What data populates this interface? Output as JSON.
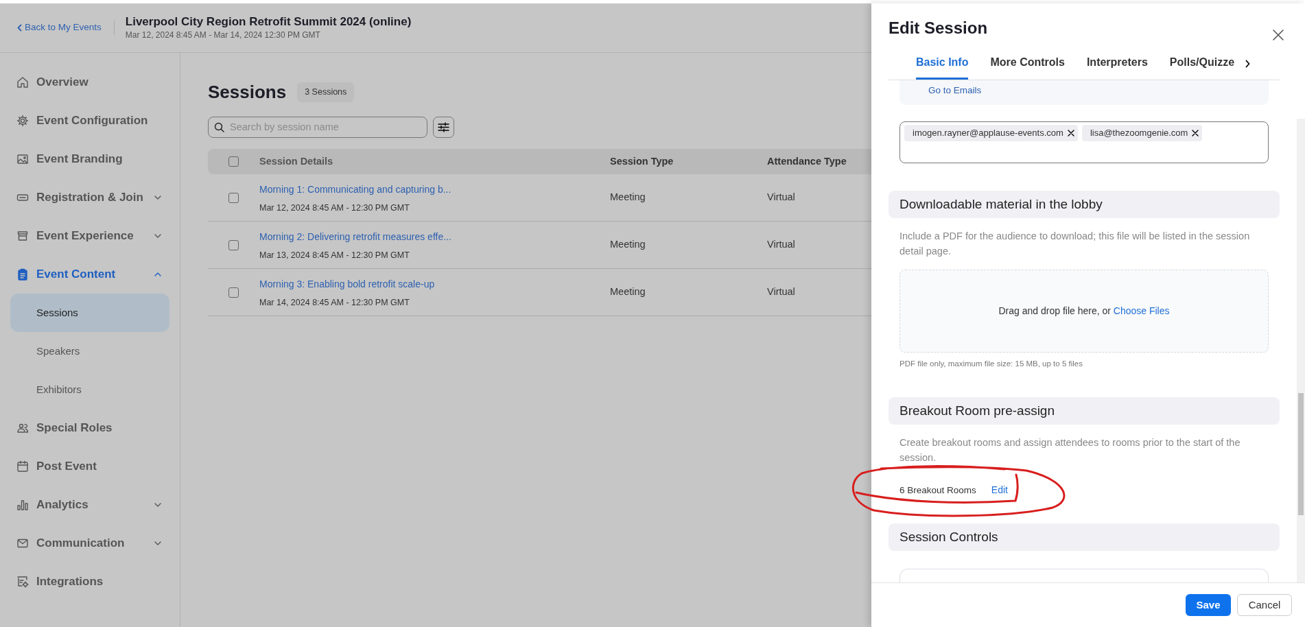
{
  "header": {
    "back_link": "Back to My Events",
    "event_title": "Liverpool City Region Retrofit Summit 2024 (online)",
    "event_dates": "Mar 12, 2024 8:45 AM - Mar 14, 2024 12:30 PM GMT"
  },
  "sidebar": {
    "items": [
      {
        "label": "Overview",
        "kind": "link",
        "selected": false
      },
      {
        "label": "Event Configuration",
        "kind": "link",
        "selected": false
      },
      {
        "label": "Event Branding",
        "kind": "link",
        "selected": false
      },
      {
        "label": "Registration & Join",
        "kind": "group",
        "expanded": false,
        "selected": false
      },
      {
        "label": "Event Experience",
        "kind": "group",
        "expanded": false,
        "selected": false
      },
      {
        "label": "Event Content",
        "kind": "group",
        "expanded": true,
        "selected": true,
        "children": [
          {
            "label": "Sessions",
            "selected": true
          },
          {
            "label": "Speakers",
            "selected": false
          },
          {
            "label": "Exhibitors",
            "selected": false
          }
        ]
      },
      {
        "label": "Special Roles",
        "kind": "link",
        "selected": false
      },
      {
        "label": "Post Event",
        "kind": "link",
        "selected": false
      },
      {
        "label": "Analytics",
        "kind": "group",
        "expanded": false,
        "selected": false
      },
      {
        "label": "Communication",
        "kind": "group",
        "expanded": false,
        "selected": false
      },
      {
        "label": "Integrations",
        "kind": "link",
        "selected": false
      }
    ]
  },
  "main": {
    "title": "Sessions",
    "count_badge": "3 Sessions",
    "search": {
      "placeholder": "Search by session name"
    },
    "table": {
      "select_all_checked": false,
      "columns": [
        "Session Details",
        "Session Type",
        "Attendance Type"
      ],
      "rows": [
        {
          "checked": false,
          "title": "Morning 1: Communicating and capturing b...",
          "dates": "Mar 12, 2024 8:45 AM - 12:30 PM GMT",
          "session_type": "Meeting",
          "attendance_type": "Virtual"
        },
        {
          "checked": false,
          "title": "Morning 2: Delivering retrofit measures effe...",
          "dates": "Mar 13, 2024 8:45 AM - 12:30 PM GMT",
          "session_type": "Meeting",
          "attendance_type": "Virtual"
        },
        {
          "checked": false,
          "title": "Morning 3: Enabling bold retrofit scale-up",
          "dates": "Mar 14, 2024 8:45 AM - 12:30 PM GMT",
          "session_type": "Meeting",
          "attendance_type": "Virtual"
        }
      ]
    }
  },
  "drawer": {
    "title": "Edit Session",
    "tabs": [
      {
        "label": "Basic Info",
        "selected": true
      },
      {
        "label": "More Controls",
        "selected": false
      },
      {
        "label": "Interpreters",
        "selected": false
      },
      {
        "label": "Polls/Quizze",
        "selected": false
      }
    ],
    "email_link": "Go to Emails",
    "recipients": [
      "imogen.rayner@applause-events.com",
      "lisa@thezoomgenie.com"
    ],
    "downloadable": {
      "heading": "Downloadable material in the lobby",
      "description": "Include a PDF for the audience to download; this file will be listed in the session detail page.",
      "dropzone_text": "Drag and drop file here, or",
      "dropzone_link": "Choose Files",
      "hint": "PDF file only, maximum file size: 15 MB, up to 5 files"
    },
    "breakout": {
      "heading": "Breakout Room pre-assign",
      "description": "Create breakout rooms and assign attendees to rooms prior to the start of the session.",
      "count": "6 Breakout Rooms",
      "edit_link": "Edit"
    },
    "session_controls": {
      "heading": "Session Controls"
    },
    "footer": {
      "save": "Save",
      "cancel": "Cancel"
    }
  }
}
